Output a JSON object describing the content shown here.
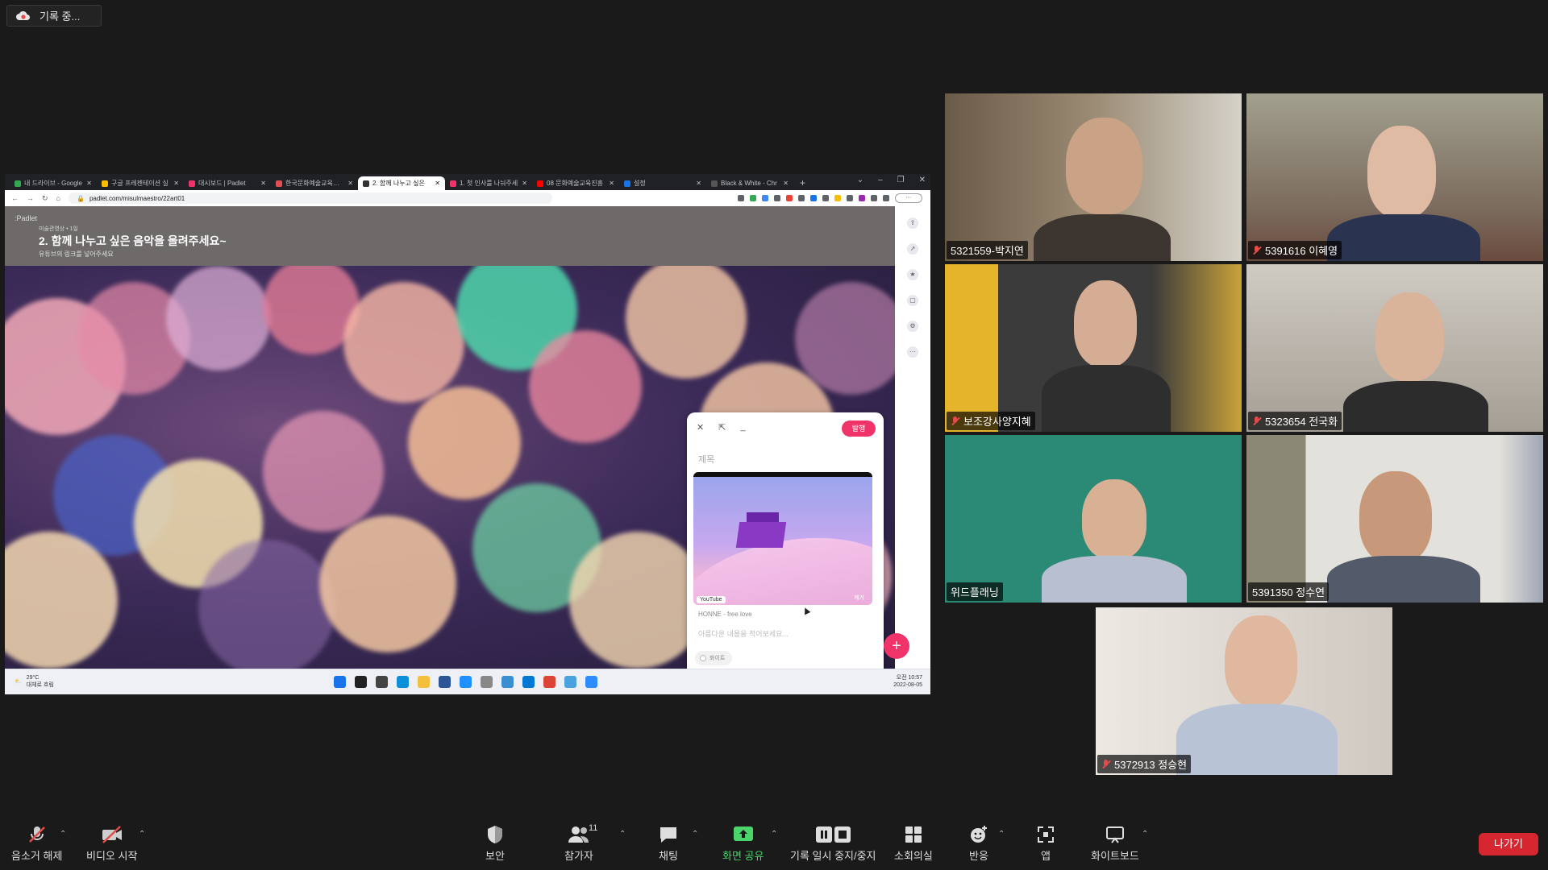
{
  "recording": {
    "label": "기록 중..."
  },
  "browser": {
    "tabs": [
      {
        "label": "내 드라이브 - Google",
        "color": "#34a853"
      },
      {
        "label": "구글 프레젠테이션 실",
        "color": "#fbbc04"
      },
      {
        "label": "대시보드 | Padlet",
        "color": "#f0346a"
      },
      {
        "label": "한국문화예술교육진흥",
        "color": "#e05050"
      },
      {
        "label": "2. 함께 나누고 싶은",
        "color": "#333333"
      },
      {
        "label": "1. 첫 인사를 나눠주세",
        "color": "#f0346a"
      },
      {
        "label": "08 문화예술교육진흥",
        "color": "#ff0000"
      },
      {
        "label": "설정",
        "color": "#1a73e8"
      },
      {
        "label": "Black & White - Chr",
        "color": "#555555"
      }
    ],
    "new_tab": "+",
    "url": "padlet.com/misulmaestro/22art01"
  },
  "padlet": {
    "logo": ":Padlet",
    "author": "미술관영상 • 1일",
    "title": "2. 함께 나누고 싶은 음악을 올려주세요~",
    "subtitle": "유튜브의 링크를 넣어주세요",
    "composer": {
      "publish": "발행",
      "title_placeholder": "제목",
      "source": "YouTube",
      "remove": "제거",
      "song": "HONNE - free love",
      "body_placeholder": "아름다운 내용을 적어보세요...",
      "color": "화이트"
    },
    "fab": "+"
  },
  "taskbar": {
    "temp": "29°C",
    "weather": "대체로 흐림",
    "time": "오전 10:57",
    "date": "2022-08-05"
  },
  "participants": [
    {
      "name": "5321559-박지연",
      "muted": false
    },
    {
      "name": "5391616 이혜영",
      "muted": true
    },
    {
      "name": "보조강사양지혜",
      "muted": true
    },
    {
      "name": "5323654 전국화",
      "muted": true
    },
    {
      "name": "위드플래닝",
      "muted": false
    },
    {
      "name": "5391350 정수연",
      "muted": false
    },
    {
      "name": "5372913 정승현",
      "muted": true
    }
  ],
  "toolbar": {
    "unmute": "음소거 해제",
    "start_video": "비디오 시작",
    "security": "보안",
    "participants": "참가자",
    "participants_count": "11",
    "chat": "채팅",
    "share_screen": "화면 공유",
    "pause_recording": "기록 일시 중지/중지",
    "breakout": "소회의실",
    "reactions": "반응",
    "apps": "앱",
    "whiteboard": "화이트보드",
    "leave": "나가기"
  },
  "colors": {
    "share_green": "#4ad46a",
    "leave_red": "#d6262f",
    "padlet_pink": "#f0346a",
    "active_speaker": "#c9e36a"
  }
}
